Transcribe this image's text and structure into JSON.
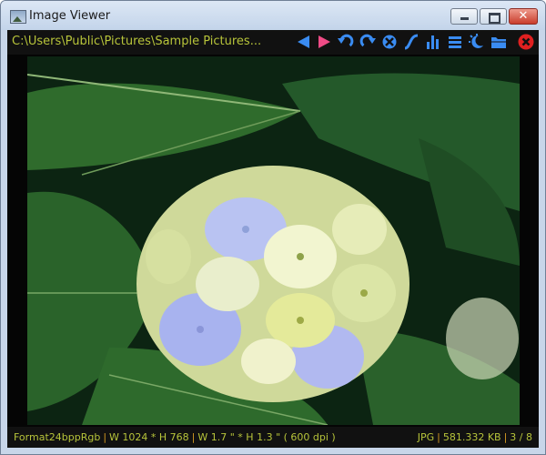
{
  "window": {
    "title": "Image Viewer"
  },
  "window_controls": {
    "minimize": "minimize-icon",
    "maximize": "maximize-icon",
    "close": "close-icon"
  },
  "toolbar": {
    "path": "C:\\Users\\Public\\Pictures\\Sample Pictures...",
    "tools": [
      {
        "icon": "previous-arrow-icon",
        "color": "#3a8cf2"
      },
      {
        "icon": "next-arrow-icon",
        "color": "#f04b86"
      },
      {
        "icon": "rotate-left-icon",
        "color": "#3a8cf2"
      },
      {
        "icon": "rotate-right-icon",
        "color": "#3a8cf2"
      },
      {
        "icon": "fit-screen-icon",
        "color": "#3a8cf2"
      },
      {
        "icon": "curve-icon",
        "color": "#3a8cf2"
      },
      {
        "icon": "histogram-icon",
        "color": "#3a8cf2"
      },
      {
        "icon": "menu-icon",
        "color": "#3a8cf2"
      },
      {
        "icon": "night-mode-icon",
        "color": "#3a8cf2"
      },
      {
        "icon": "folder-open-icon",
        "color": "#3a8cf2"
      },
      {
        "icon": "close-image-icon",
        "color": "#e02020"
      }
    ]
  },
  "image": {
    "subject": "hydrangea-photo"
  },
  "status": {
    "format": "Format24bppRgb",
    "pixels": "W 1024 * H 768",
    "print_size": "W 1.7 \" * H 1.3 \" ( 600 dpi )",
    "type": "JPG",
    "file_size": "581.332 KB",
    "position": "3 / 8"
  },
  "colors": {
    "accent_text": "#b7c43a",
    "separator": "#d59a22",
    "toolbar_bg": "#111111"
  }
}
